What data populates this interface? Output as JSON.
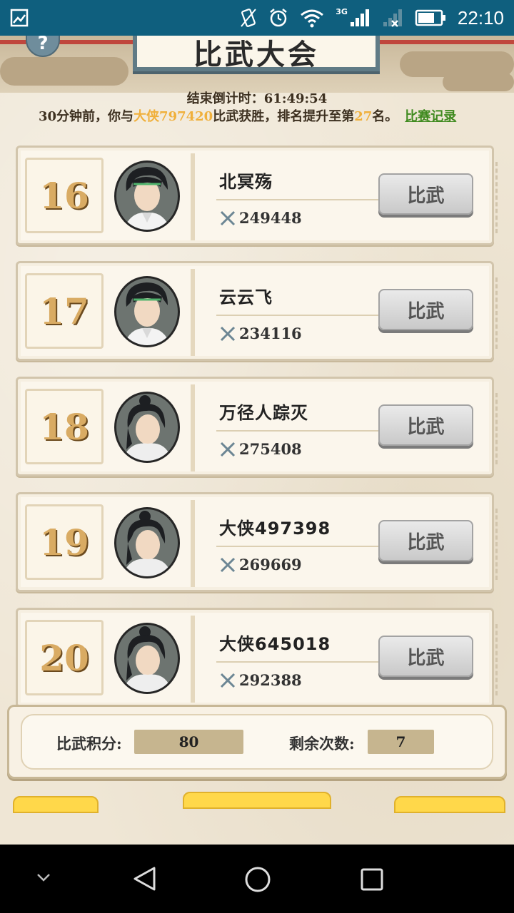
{
  "status_bar": {
    "time": "22:10",
    "network": "3G",
    "icons": [
      "image-icon",
      "vibrate-icon",
      "alarm-icon",
      "wifi-icon",
      "signal-icon",
      "no-signal-icon",
      "battery-icon"
    ]
  },
  "header": {
    "title": "比武大会",
    "help": "?"
  },
  "countdown": {
    "label": "结束倒计时：",
    "value": "61:49:54"
  },
  "notice": {
    "part1": "30分钟前，你与",
    "opponent": "大侠797420",
    "part2": "比武获胜，排名提升至第",
    "rank": "27",
    "part3": "名。",
    "record_link": "比赛记录"
  },
  "ranking": [
    {
      "rank": "16",
      "name": "北冥殇",
      "power": "249448",
      "button": "比武"
    },
    {
      "rank": "17",
      "name": "云云飞",
      "power": "234116",
      "button": "比武"
    },
    {
      "rank": "18",
      "name": "万径人踪灭",
      "power": "275408",
      "button": "比武"
    },
    {
      "rank": "19",
      "name": "大侠497398",
      "power": "269669",
      "button": "比武"
    },
    {
      "rank": "20",
      "name": "大侠645018",
      "power": "292388",
      "button": "比武"
    }
  ],
  "bottom": {
    "score_label": "比武积分:",
    "score_value": "80",
    "remaining_label": "剩余次数:",
    "remaining_value": "7"
  },
  "colors": {
    "status_bar": "#0f5f7e",
    "highlight": "#f0b03c",
    "link": "#3f8a1f",
    "rank_number": "#d9ab63",
    "stat_box": "#c6b58f"
  }
}
